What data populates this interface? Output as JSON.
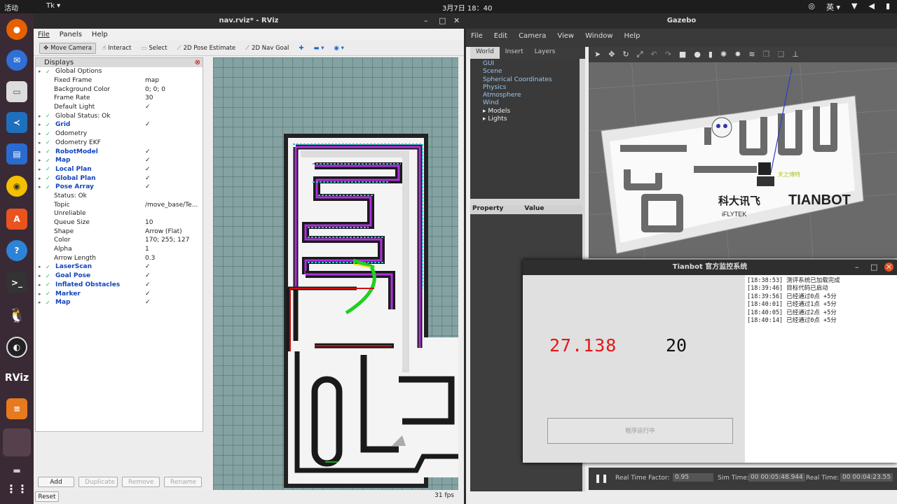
{
  "topbar": {
    "activities": "活动",
    "app": "Tk ▾",
    "clock": "3月7日 18：40",
    "lang": "英 ▾"
  },
  "rviz": {
    "title": "nav.rviz* - RViz",
    "menu": [
      "File",
      "Panels",
      "Help"
    ],
    "tools": [
      "Move Camera",
      "Interact",
      "Select",
      "2D Pose Estimate",
      "2D Nav Goal"
    ],
    "panel_title": "Displays",
    "rows": [
      {
        "name": "Global Options",
        "value": "",
        "indent": 1,
        "blue": false
      },
      {
        "name": "Fixed Frame",
        "value": "map",
        "indent": 2,
        "blue": false
      },
      {
        "name": "Background Color",
        "value": "0; 0; 0",
        "indent": 2,
        "blue": false
      },
      {
        "name": "Frame Rate",
        "value": "30",
        "indent": 2,
        "blue": false
      },
      {
        "name": "Default Light",
        "value": "✓",
        "indent": 2,
        "blue": false
      },
      {
        "name": "Global Status: Ok",
        "value": "",
        "indent": 1,
        "blue": false
      },
      {
        "name": "Grid",
        "value": "✓",
        "indent": 1,
        "blue": true
      },
      {
        "name": "Odometry",
        "value": "",
        "indent": 1,
        "blue": false
      },
      {
        "name": "Odometry EKF",
        "value": "",
        "indent": 1,
        "blue": false
      },
      {
        "name": "RobotModel",
        "value": "✓",
        "indent": 1,
        "blue": true
      },
      {
        "name": "Map",
        "value": "✓",
        "indent": 1,
        "blue": true
      },
      {
        "name": "Local Plan",
        "value": "✓",
        "indent": 1,
        "blue": true
      },
      {
        "name": "Global Plan",
        "value": "✓",
        "indent": 1,
        "blue": true
      },
      {
        "name": "Pose Array",
        "value": "✓",
        "indent": 1,
        "blue": true
      },
      {
        "name": "Status: Ok",
        "value": "",
        "indent": 2,
        "blue": false
      },
      {
        "name": "Topic",
        "value": "/move_base/Te...",
        "indent": 2,
        "blue": false
      },
      {
        "name": "Unreliable",
        "value": "",
        "indent": 2,
        "blue": false
      },
      {
        "name": "Queue Size",
        "value": "10",
        "indent": 2,
        "blue": false
      },
      {
        "name": "Shape",
        "value": "Arrow (Flat)",
        "indent": 2,
        "blue": false
      },
      {
        "name": "Color",
        "value": "170; 255; 127",
        "indent": 2,
        "blue": false
      },
      {
        "name": "Alpha",
        "value": "1",
        "indent": 2,
        "blue": false
      },
      {
        "name": "Arrow Length",
        "value": "0.3",
        "indent": 2,
        "blue": false
      },
      {
        "name": "LaserScan",
        "value": "✓",
        "indent": 1,
        "blue": true
      },
      {
        "name": "Goal Pose",
        "value": "✓",
        "indent": 1,
        "blue": true
      },
      {
        "name": "Inflated Obstacles",
        "value": "✓",
        "indent": 1,
        "blue": true
      },
      {
        "name": "Marker",
        "value": "✓",
        "indent": 1,
        "blue": true
      },
      {
        "name": "Map",
        "value": "✓",
        "indent": 1,
        "blue": true
      }
    ],
    "buttons": [
      "Add",
      "Duplicate",
      "Remove",
      "Rename"
    ],
    "reset": "Reset",
    "fps": "31 fps"
  },
  "gazebo": {
    "title": "Gazebo",
    "menu": [
      "File",
      "Edit",
      "Camera",
      "View",
      "Window",
      "Help"
    ],
    "tabs": [
      "World",
      "Insert",
      "Layers"
    ],
    "tree": [
      "GUI",
      "Scene",
      "Spherical Coordinates",
      "Physics",
      "Atmosphere",
      "Wind",
      "▸ Models",
      "▸ Lights"
    ],
    "prop_headers": [
      "Property",
      "Value"
    ],
    "rtf_label": "Real Time Factor:",
    "rtf": "0.95",
    "sim_label": "Sim Time:",
    "sim": "00 00:05:48.944",
    "real_label": "Real Time:",
    "real": "00 00:04:23.55",
    "brand1": "科大讯飞",
    "brand2": "TIANBOT",
    "brand3": "天之博特",
    "brand4": "iFLYTEK"
  },
  "monitor": {
    "title": "Tianbot 官方监控系统",
    "timer": "27.138",
    "score": "20",
    "status": "程序运行中",
    "log": [
      "[18:38:53]  测评系统已加载完成",
      "[18:39:46]  目标代码已启动",
      "[18:39:56]  已经通过0点 +5分",
      "[18:40:01]  已经通过1点 +5分",
      "[18:40:05]  已经通过2点 +5分",
      "[18:40:14]  已经通过0点 +5分"
    ]
  }
}
